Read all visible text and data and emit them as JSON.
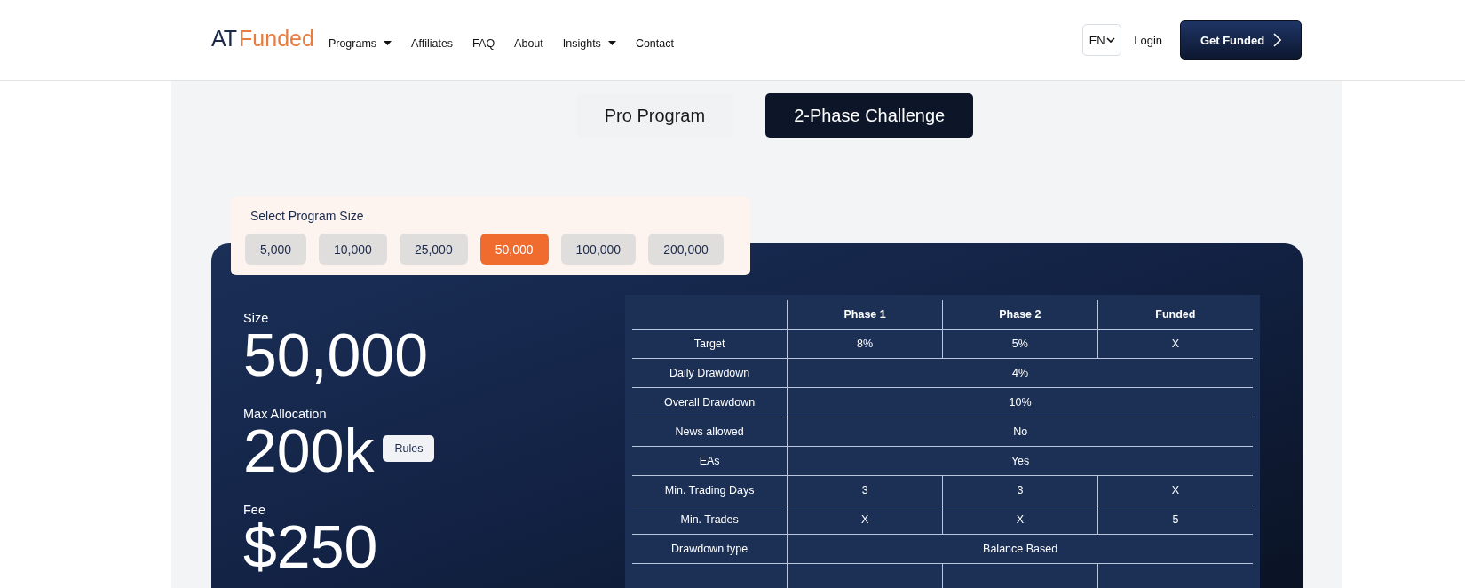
{
  "header": {
    "logo": {
      "mark": "AT",
      "word": "Funded"
    },
    "nav": [
      {
        "label": "Programs",
        "dropdown": true
      },
      {
        "label": "Affiliates",
        "dropdown": false
      },
      {
        "label": "FAQ",
        "dropdown": false
      },
      {
        "label": "About",
        "dropdown": false
      },
      {
        "label": "Insights",
        "dropdown": true
      },
      {
        "label": "Contact",
        "dropdown": false
      }
    ],
    "language": "EN",
    "login": "Login",
    "cta": "Get Funded"
  },
  "program_tabs": [
    {
      "label": "Pro Program",
      "selected": false
    },
    {
      "label": "2-Phase Challenge",
      "selected": true
    }
  ],
  "size_selector": {
    "title": "Select Program Size",
    "options": [
      {
        "label": "5,000",
        "selected": false
      },
      {
        "label": "10,000",
        "selected": false
      },
      {
        "label": "25,000",
        "selected": false
      },
      {
        "label": "50,000",
        "selected": true
      },
      {
        "label": "100,000",
        "selected": false
      },
      {
        "label": "200,000",
        "selected": false
      }
    ]
  },
  "summary": [
    {
      "label": "Size",
      "value": "50,000"
    },
    {
      "label": "Max Allocation",
      "value": "200k",
      "button": "Rules"
    },
    {
      "label": "Fee",
      "value": "$250"
    }
  ],
  "table": {
    "columns": [
      "Phase 1",
      "Phase 2",
      "Funded"
    ],
    "rows": [
      {
        "label": "Target",
        "cells": [
          "8%",
          "5%",
          "X"
        ]
      },
      {
        "label": "Daily Drawdown",
        "cells": [
          {
            "text": "4%",
            "colspan": 3
          }
        ]
      },
      {
        "label": "Overall Drawdown",
        "cells": [
          {
            "text": "10%",
            "colspan": 3
          }
        ]
      },
      {
        "label": "News allowed",
        "cells": [
          {
            "text": "No",
            "colspan": 3
          }
        ]
      },
      {
        "label": "EAs",
        "cells": [
          {
            "text": "Yes",
            "colspan": 3
          }
        ]
      },
      {
        "label": "Min. Trading Days",
        "cells": [
          "3",
          "3",
          "X"
        ]
      },
      {
        "label": "Min. Trades",
        "cells": [
          "X",
          "X",
          "5"
        ]
      },
      {
        "label": "Drawdown type",
        "cells": [
          {
            "text": "Balance Based",
            "colspan": 3
          }
        ]
      }
    ]
  }
}
